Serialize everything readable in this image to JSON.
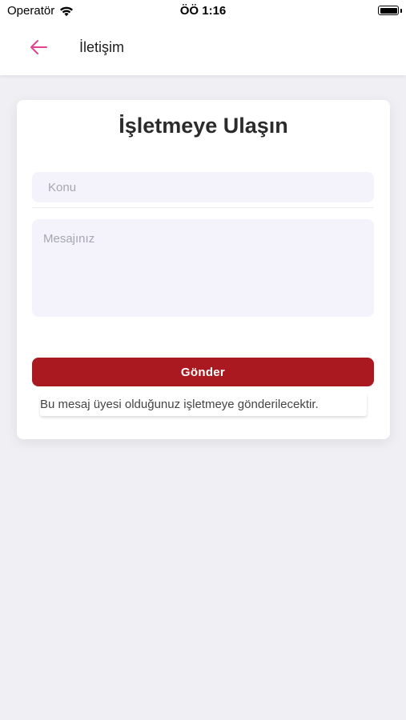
{
  "status_bar": {
    "carrier": "Operatör",
    "time": "ÖÖ 1:16",
    "icons": [
      "wifi-icon",
      "battery-icon"
    ]
  },
  "app_bar": {
    "title": "İletişim",
    "back_icon": "arrow-left-icon",
    "accent_color": "#e0448e"
  },
  "contact_form": {
    "title": "İşletmeye Ulaşın",
    "subject_placeholder": "Konu",
    "subject_value": "",
    "message_placeholder": "Mesajınız",
    "message_value": "",
    "send_label": "Gönder",
    "send_color": "#ab1920",
    "note": "Bu mesaj üyesi olduğunuz işletmeye gönderilecektir."
  }
}
